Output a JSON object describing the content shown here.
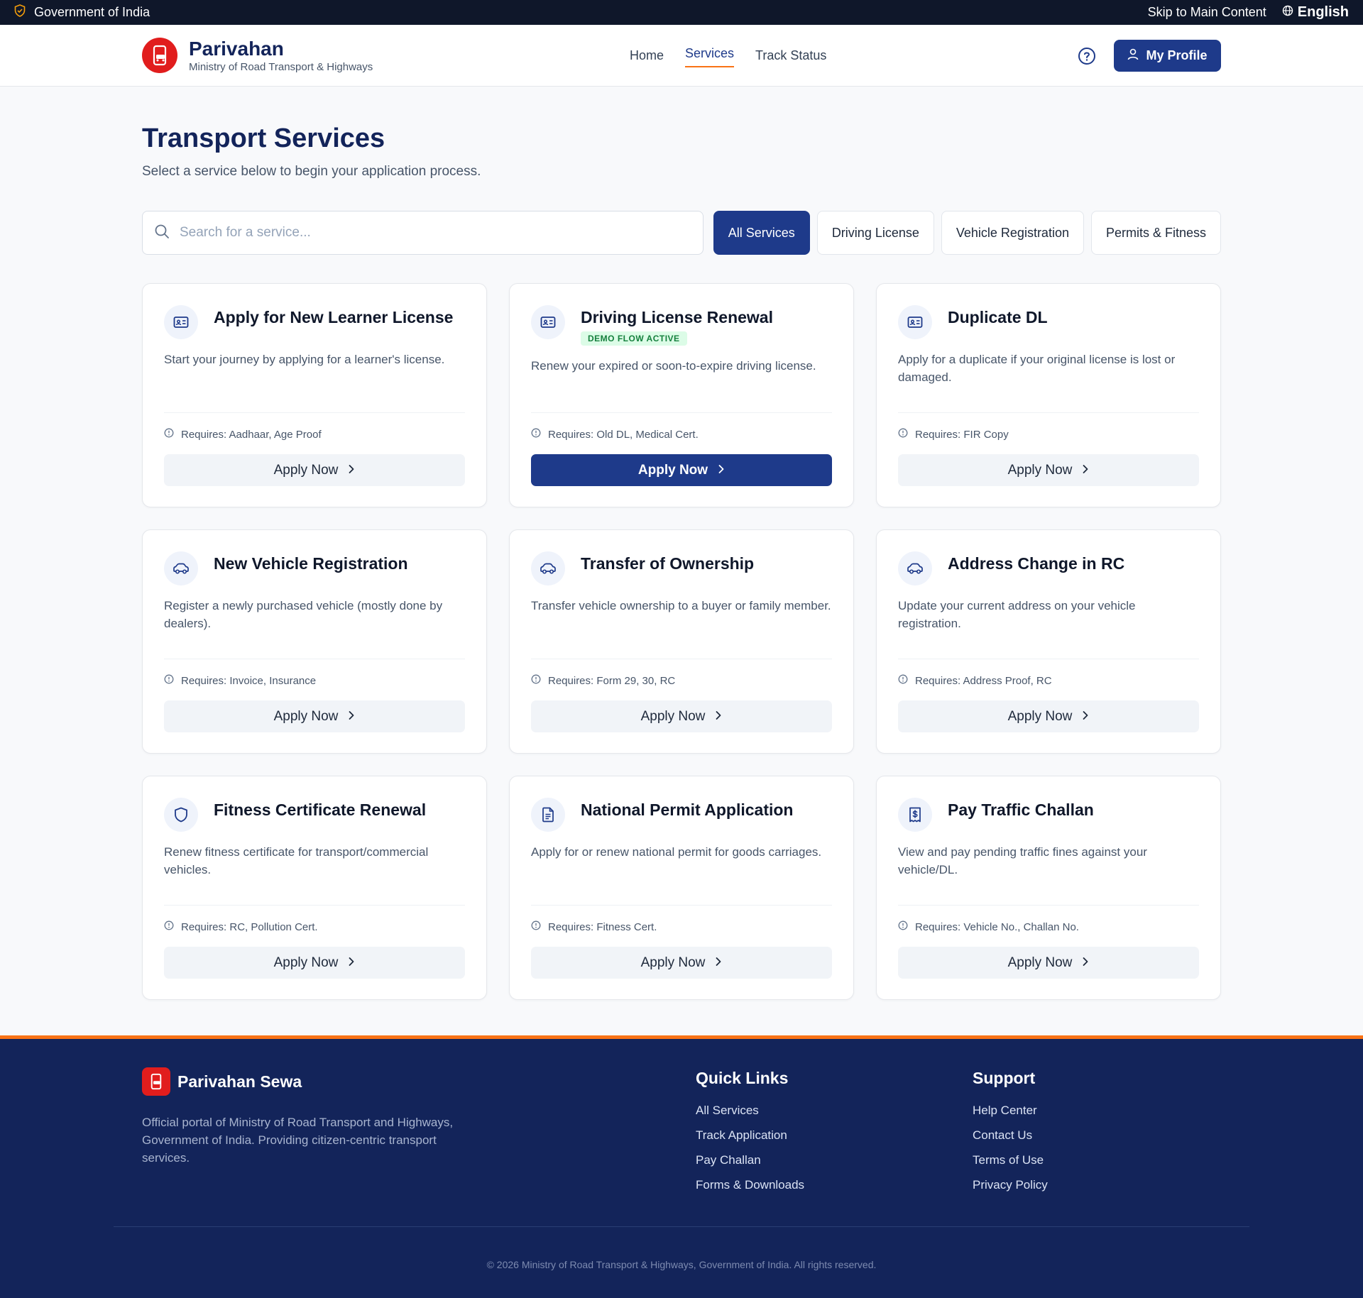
{
  "gov_bar": {
    "label": "Government of India",
    "skip_link": "Skip to Main Content",
    "language": "English"
  },
  "header": {
    "brand_title": "Parivahan",
    "brand_subtitle": "Ministry of Road Transport & Highways",
    "nav": [
      {
        "label": "Home",
        "active": false
      },
      {
        "label": "Services",
        "active": true
      },
      {
        "label": "Track Status",
        "active": false
      }
    ],
    "profile_label": "My Profile"
  },
  "page": {
    "title": "Transport Services",
    "subtitle": "Select a service below to begin your application process."
  },
  "search": {
    "placeholder": "Search for a service...",
    "value": ""
  },
  "filters": [
    {
      "label": "All Services",
      "active": true
    },
    {
      "label": "Driving License",
      "active": false
    },
    {
      "label": "Vehicle Registration",
      "active": false
    },
    {
      "label": "Permits & Fitness",
      "active": false
    }
  ],
  "services": [
    {
      "title": "Apply for New Learner License",
      "description": "Start your journey by applying for a learner's license.",
      "requires": "Requires: Aadhaar, Age Proof",
      "button": "Apply Now",
      "icon": "id-card-icon",
      "badge": "",
      "primary": false
    },
    {
      "title": "Driving License Renewal",
      "description": "Renew your expired or soon-to-expire driving license.",
      "requires": "Requires: Old DL, Medical Cert.",
      "button": "Apply Now",
      "icon": "id-card-icon",
      "badge": "DEMO FLOW ACTIVE",
      "primary": true
    },
    {
      "title": "Duplicate DL",
      "description": "Apply for a duplicate if your original license is lost or damaged.",
      "requires": "Requires: FIR Copy",
      "button": "Apply Now",
      "icon": "id-card-icon",
      "badge": "",
      "primary": false
    },
    {
      "title": "New Vehicle Registration",
      "description": "Register a newly purchased vehicle (mostly done by dealers).",
      "requires": "Requires: Invoice, Insurance",
      "button": "Apply Now",
      "icon": "car-icon",
      "badge": "",
      "primary": false
    },
    {
      "title": "Transfer of Ownership",
      "description": "Transfer vehicle ownership to a buyer or family member.",
      "requires": "Requires: Form 29, 30, RC",
      "button": "Apply Now",
      "icon": "car-icon",
      "badge": "",
      "primary": false
    },
    {
      "title": "Address Change in RC",
      "description": "Update your current address on your vehicle registration.",
      "requires": "Requires: Address Proof, RC",
      "button": "Apply Now",
      "icon": "car-icon",
      "badge": "",
      "primary": false
    },
    {
      "title": "Fitness Certificate Renewal",
      "description": "Renew fitness certificate for transport/commercial vehicles.",
      "requires": "Requires: RC, Pollution Cert.",
      "button": "Apply Now",
      "icon": "shield-icon",
      "badge": "",
      "primary": false
    },
    {
      "title": "National Permit Application",
      "description": "Apply for or renew national permit for goods carriages.",
      "requires": "Requires: Fitness Cert.",
      "button": "Apply Now",
      "icon": "document-icon",
      "badge": "",
      "primary": false
    },
    {
      "title": "Pay Traffic Challan",
      "description": "View and pay pending traffic fines against your vehicle/DL.",
      "requires": "Requires: Vehicle No., Challan No.",
      "button": "Apply Now",
      "icon": "receipt-dollar-icon",
      "badge": "",
      "primary": false
    }
  ],
  "footer": {
    "brand": "Parivahan Sewa",
    "description": "Official portal of Ministry of Road Transport and Highways, Government of India. Providing citizen-centric transport services.",
    "quick_links_title": "Quick Links",
    "quick_links": [
      "All Services",
      "Track Application",
      "Pay Challan",
      "Forms & Downloads"
    ],
    "support_title": "Support",
    "support_links": [
      "Help Center",
      "Contact Us",
      "Terms of Use",
      "Privacy Policy"
    ],
    "copyright": "© 2026 Ministry of Road Transport & Highways, Government of India. All rights reserved."
  },
  "colors": {
    "primary": "#1e3a8a",
    "accent": "#f97316",
    "brand_red": "#e11d1d",
    "footer_bg": "#13245a",
    "badge_bg": "#dcfce7",
    "badge_text": "#15803d"
  }
}
